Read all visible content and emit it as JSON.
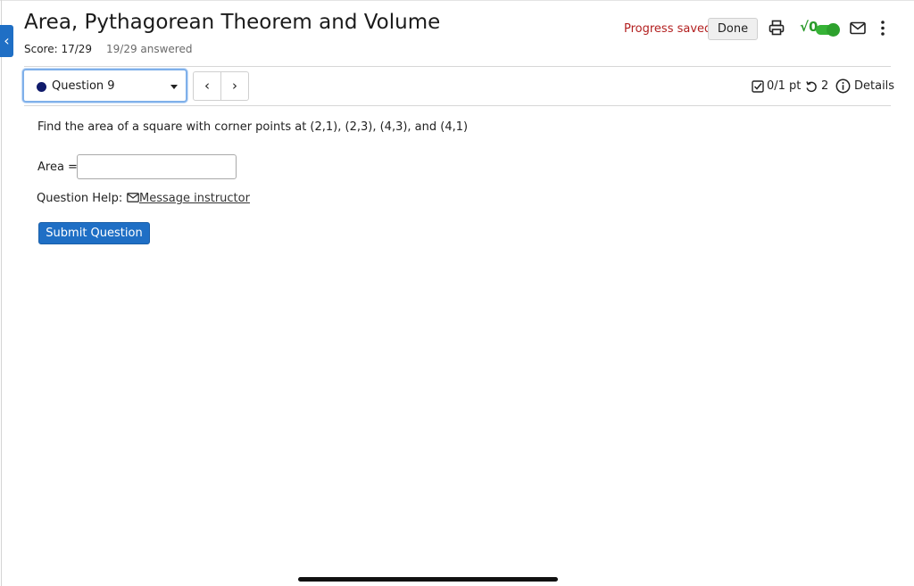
{
  "header": {
    "title": "Area, Pythagorean Theorem and Volume",
    "score": "Score: 17/29",
    "answered": "19/29 answered",
    "progress_status": "Progress saved",
    "done_label": "Done",
    "icons": [
      "chevron-left-icon",
      "print-icon",
      "sqrt-icon",
      "toggle-switch",
      "mail-icon",
      "kebab-menu-icon"
    ],
    "colors": {
      "primary": "#1f6fc5",
      "progress": "#b32020",
      "toggle": "#36b336"
    }
  },
  "question_nav": {
    "selected": "Question 9",
    "prev_glyph": "‹",
    "next_glyph": "›",
    "points": "0/1 pt",
    "attempts": "2",
    "details_label": "Details"
  },
  "question": {
    "prompt": "Find the area of a square with corner points at (2,1), (2,3), (4,3), and (4,1)",
    "area_label": "Area =",
    "area_value": "",
    "help_label": "Question Help:",
    "message_label": "Message instructor",
    "submit_label": "Submit Question"
  }
}
